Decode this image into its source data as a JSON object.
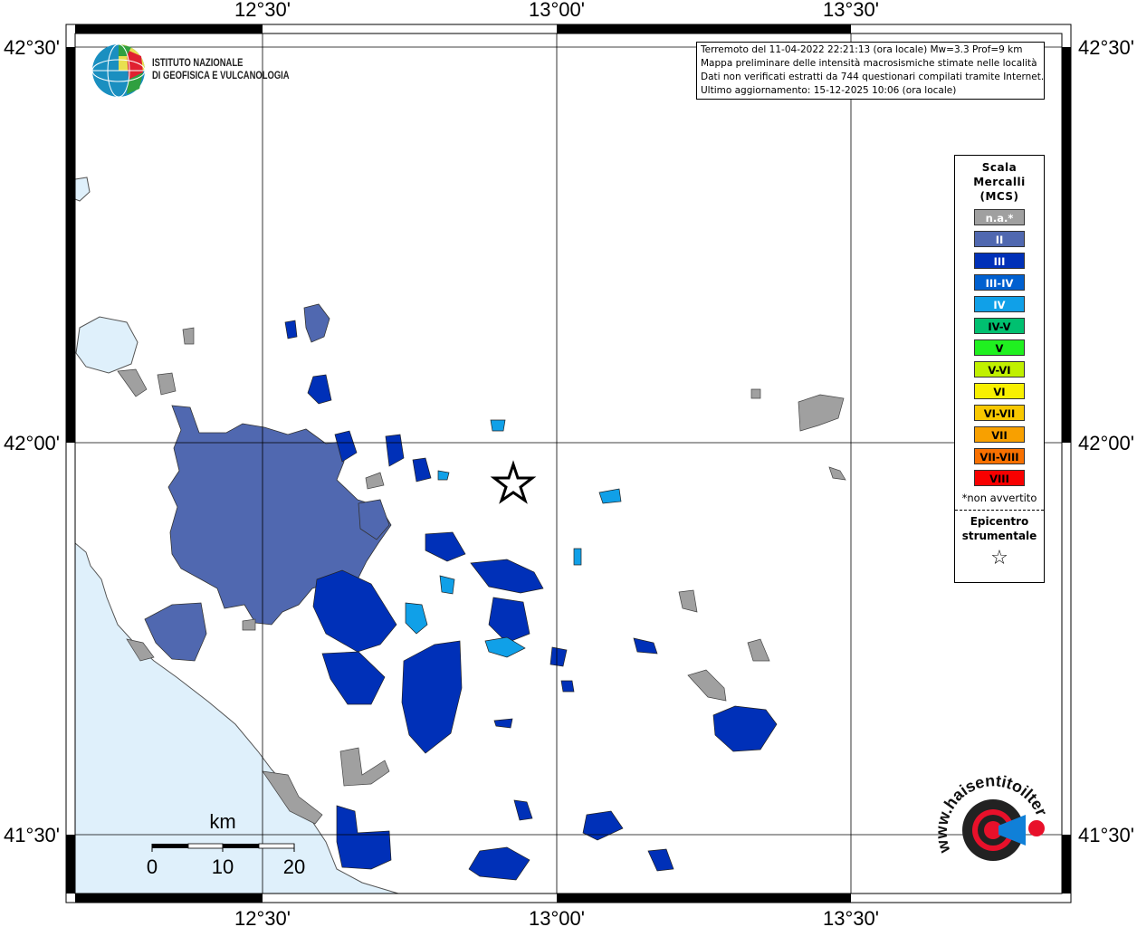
{
  "axes": {
    "lon_ticks": [
      "12°30'",
      "13°00'",
      "13°30'"
    ],
    "lat_ticks": [
      "42°30'",
      "42°00'",
      "41°30'"
    ]
  },
  "info_box": {
    "line1": "Terremoto del 11-04-2022 22:21:13 (ora locale) Mw=3.3 Prof=9 km",
    "line2": "Mappa preliminare delle intensità macrosismiche stimate nelle località",
    "line3": "Dati non verificati estratti da 744 questionari compilati tramite Internet.",
    "line4": "Ultimo aggiornamento: 15-12-2025 10:06 (ora locale)"
  },
  "institute": {
    "line1": "ISTITUTO NAZIONALE",
    "line2": "DI GEOFISICA E VULCANOLOGIA"
  },
  "legend": {
    "title1": "Scala",
    "title2": "Mercalli",
    "title3": "(MCS)",
    "items": [
      {
        "label": "n.a.*",
        "color": "#a0a0a0",
        "text": "#ffffff"
      },
      {
        "label": "II",
        "color": "#5068b0",
        "text": "#ffffff"
      },
      {
        "label": "III",
        "color": "#0030b8",
        "text": "#ffffff"
      },
      {
        "label": "III-IV",
        "color": "#0060d0",
        "text": "#ffffff"
      },
      {
        "label": "IV",
        "color": "#10a0e8",
        "text": "#ffffff"
      },
      {
        "label": "IV-V",
        "color": "#00c070",
        "text": "#000000"
      },
      {
        "label": "V",
        "color": "#20f020",
        "text": "#000000"
      },
      {
        "label": "V-VI",
        "color": "#c0f000",
        "text": "#000000"
      },
      {
        "label": "VI",
        "color": "#f8f000",
        "text": "#000000"
      },
      {
        "label": "VI-VII",
        "color": "#f8c800",
        "text": "#000000"
      },
      {
        "label": "VII",
        "color": "#f8a000",
        "text": "#000000"
      },
      {
        "label": "VII-VIII",
        "color": "#f87000",
        "text": "#000000"
      },
      {
        "label": "VIII",
        "color": "#f80000",
        "text": "#000000"
      }
    ],
    "note": "*non avvertito",
    "epicenter1": "Epicentro",
    "epicenter2": "strumentale",
    "epicenter_symbol": "☆"
  },
  "scale_bar": {
    "unit": "km",
    "labels": [
      "0",
      "10",
      "20"
    ]
  },
  "site_logo": {
    "text": "www.haisentitoilterremoto.it"
  },
  "colors": {
    "sea": "#dff0fb",
    "grid": "#000000"
  }
}
